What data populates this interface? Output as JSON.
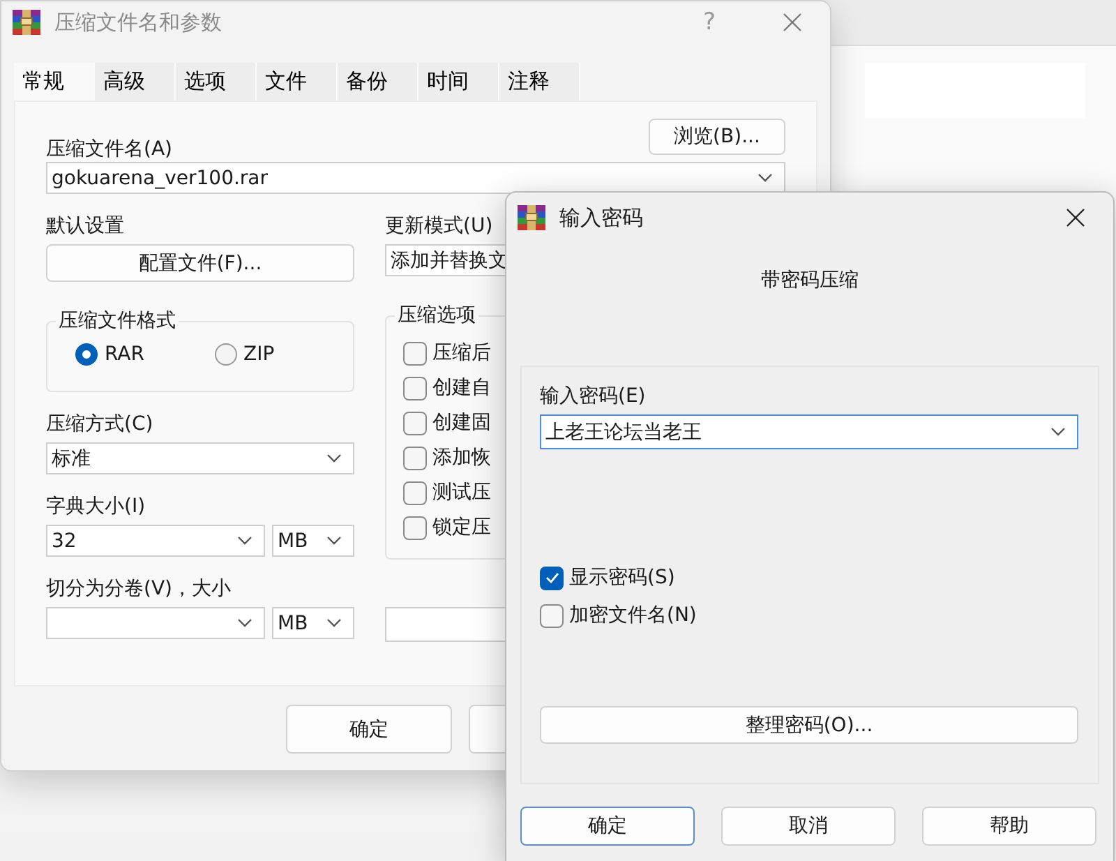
{
  "main_window": {
    "title": "压缩文件名和参数",
    "help_button": "?",
    "tabs": [
      {
        "label": "常规",
        "selected": true
      },
      {
        "label": "高级",
        "selected": false
      },
      {
        "label": "选项",
        "selected": false
      },
      {
        "label": "文件",
        "selected": false
      },
      {
        "label": "备份",
        "selected": false
      },
      {
        "label": "时间",
        "selected": false
      },
      {
        "label": "注释",
        "selected": false
      }
    ],
    "archive_name_label": "压缩文件名(A)",
    "browse_button": "浏览(B)...",
    "archive_name": "gokuarena_ver100.rar",
    "profiles_label": "默认设置",
    "profiles_button": "配置文件(F)...",
    "update_mode_label": "更新模式(U)",
    "update_mode": "添加并替换文",
    "format_group": {
      "title": "压缩文件格式",
      "options": [
        {
          "label": "RAR",
          "selected": true
        },
        {
          "label": "ZIP",
          "selected": false
        }
      ]
    },
    "options_group": {
      "title": "压缩选项",
      "options": [
        {
          "label": "压缩后",
          "checked": false
        },
        {
          "label": "创建自",
          "checked": false
        },
        {
          "label": "创建固",
          "checked": false
        },
        {
          "label": "添加恢",
          "checked": false
        },
        {
          "label": "测试压",
          "checked": false
        },
        {
          "label": "锁定压",
          "checked": false
        }
      ]
    },
    "method_label": "压缩方式(C)",
    "method": "标准",
    "dictionary_label": "字典大小(I)",
    "dictionary": "32",
    "dictionary_unit": "MB",
    "volume_label": "切分为分卷(V)，大小",
    "volume_unit": "MB",
    "ok_button": "确定"
  },
  "password_dialog": {
    "title": "输入密码",
    "heading": "带密码压缩",
    "password_label": "输入密码(E)",
    "password": "上老王论坛当老王",
    "options": [
      {
        "label": "显示密码(S)",
        "checked": true
      },
      {
        "label": "加密文件名(N)",
        "checked": false
      }
    ],
    "organize_button": "整理密码(O)...",
    "buttons": [
      {
        "label": "确定",
        "default": true
      },
      {
        "label": "取消",
        "default": false
      },
      {
        "label": "帮助",
        "default": false
      }
    ]
  }
}
